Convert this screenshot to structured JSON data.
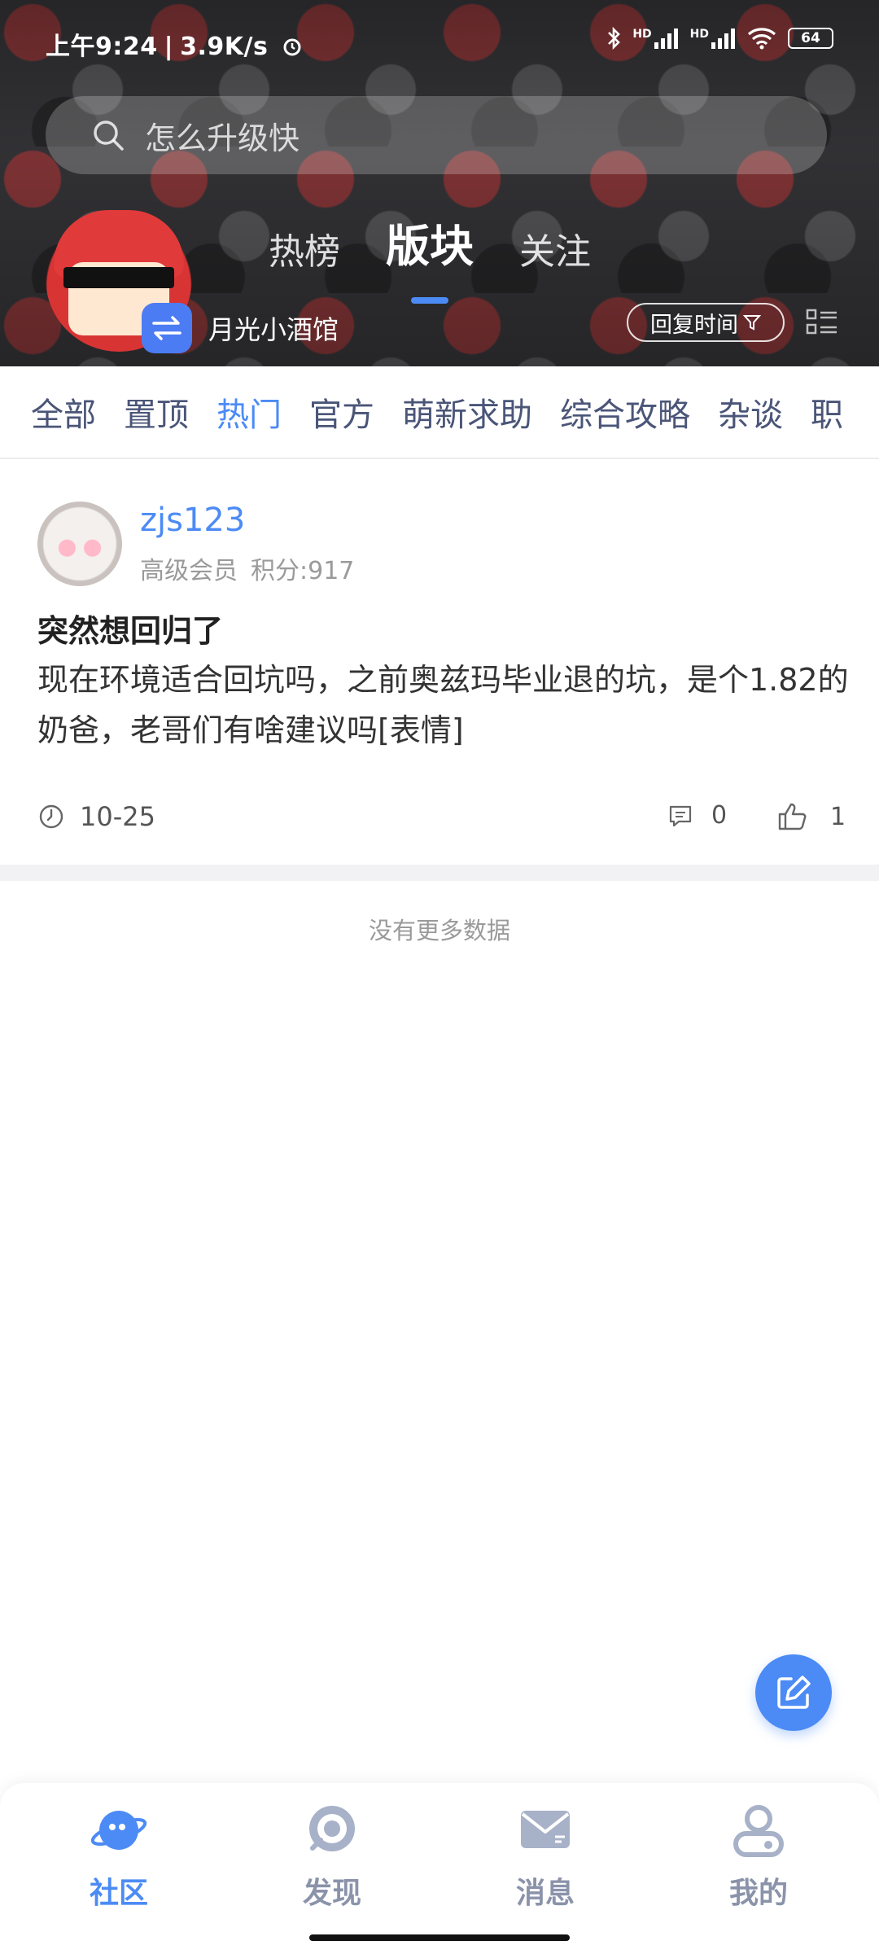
{
  "status_bar": {
    "time": "上午9:24",
    "network_speed": "3.9K/s",
    "signal_1": "HD",
    "signal_2": "HD",
    "battery": "64"
  },
  "search": {
    "placeholder": "怎么升级快"
  },
  "board": {
    "name": "月光小酒馆"
  },
  "top_tabs": [
    {
      "label": "热榜"
    },
    {
      "label": "版块"
    },
    {
      "label": "关注"
    }
  ],
  "top_tabs_active": 1,
  "sort": {
    "label": "回复时间"
  },
  "categories": [
    {
      "label": "全部"
    },
    {
      "label": "置顶"
    },
    {
      "label": "热门"
    },
    {
      "label": "官方"
    },
    {
      "label": "萌新求助"
    },
    {
      "label": "综合攻略"
    },
    {
      "label": "杂谈"
    },
    {
      "label": "职"
    }
  ],
  "categories_active": 2,
  "post": {
    "username": "zjs123",
    "member_level": "高级会员",
    "points": "积分:917",
    "title": "突然想回归了",
    "body": "现在环境适合回坑吗，之前奥兹玛毕业退的坑，是个1.82的奶爸，老哥们有啥建议吗[表情]",
    "date": "10-25",
    "comment_count": "0",
    "like_count": "1"
  },
  "list_end_text": "没有更多数据",
  "bottom_nav": [
    {
      "label": "社区",
      "icon": "planet-icon"
    },
    {
      "label": "发现",
      "icon": "radar-icon"
    },
    {
      "label": "消息",
      "icon": "mail-icon"
    },
    {
      "label": "我的",
      "icon": "user-icon"
    }
  ],
  "bottom_nav_active": 0,
  "colors": {
    "accent": "#4c8bf5",
    "category_text": "#4a5578",
    "muted": "#9a9a9a"
  }
}
